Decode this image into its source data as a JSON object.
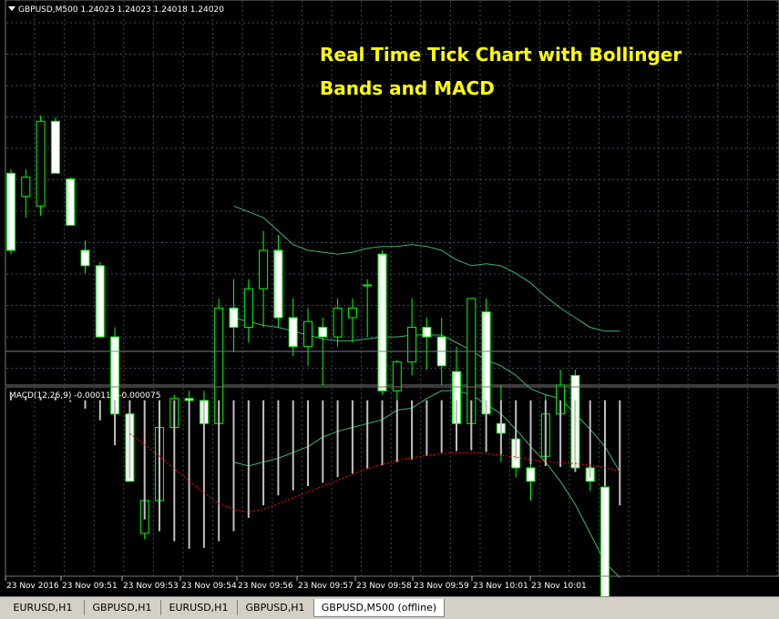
{
  "header": {
    "symbol_info": "GBPUSD,M500  1.24023 1.24023 1.24018 1.24020",
    "menu_icon": "triangle-down-icon"
  },
  "annotation": {
    "line1": "Real Time Tick Chart with Bollinger",
    "line2": "Bands and MACD",
    "color": "#ffff00"
  },
  "macd_panel": {
    "label": "MACD(12,26,9) -0.000119 -0.000075"
  },
  "time_axis": {
    "labels": [
      "23 Nov 2016",
      "23 Nov 09:51",
      "23 Nov 09:53",
      "23 Nov 09:54",
      "23 Nov 09:56",
      "23 Nov 09:57",
      "23 Nov 09:58",
      "23 Nov 09:59",
      "23 Nov 10:01",
      "23 Nov 10:01"
    ]
  },
  "tabs": [
    {
      "label": "EURUSD,H1",
      "active": false
    },
    {
      "label": "GBPUSD,H1",
      "active": false
    },
    {
      "label": "EURUSD,H1",
      "active": false
    },
    {
      "label": "GBPUSD,H1",
      "active": false
    },
    {
      "label": "GBPUSD,M500 (offline)",
      "active": true
    }
  ],
  "colors": {
    "background": "#000000",
    "grid": "#3a4a5a",
    "candle_border": "#00ff00",
    "bull_fill": "#000000",
    "bear_fill": "#ffffff",
    "bands": "#3cb371",
    "histogram": "#c0c0c0",
    "signal": "#ff0000",
    "bid_line": "#708090"
  },
  "chart_data": [
    {
      "type": "candlestick",
      "ylim": [
        1.239,
        1.241
      ],
      "grid": true,
      "candles": [
        {
          "o": 1.2401,
          "h": 1.24012,
          "l": 1.23968,
          "c": 1.2397
        },
        {
          "o": 1.23998,
          "h": 1.24012,
          "l": 1.23987,
          "c": 1.24008
        },
        {
          "o": 1.23993,
          "h": 1.2404,
          "l": 1.23988,
          "c": 1.24037
        },
        {
          "o": 1.24037,
          "h": 1.24039,
          "l": 1.2401,
          "c": 1.2401
        },
        {
          "o": 1.24007,
          "h": 1.24008,
          "l": 1.23983,
          "c": 1.23983
        },
        {
          "o": 1.2397,
          "h": 1.23975,
          "l": 1.23958,
          "c": 1.23962
        },
        {
          "o": 1.23962,
          "h": 1.23964,
          "l": 1.23925,
          "c": 1.23925
        },
        {
          "o": 1.23925,
          "h": 1.2393,
          "l": 1.23885,
          "c": 1.23885
        },
        {
          "o": 1.23885,
          "h": 1.2389,
          "l": 1.2385,
          "c": 1.2385
        },
        {
          "o": 1.23823,
          "h": 1.23845,
          "l": 1.2382,
          "c": 1.2384
        },
        {
          "o": 1.2384,
          "h": 1.2388,
          "l": 1.23838,
          "c": 1.23878
        },
        {
          "o": 1.23878,
          "h": 1.23895,
          "l": 1.23873,
          "c": 1.23893
        },
        {
          "o": 1.23893,
          "h": 1.23897,
          "l": 1.23865,
          "c": 1.23892
        },
        {
          "o": 1.23892,
          "h": 1.23897,
          "l": 1.23863,
          "c": 1.2388
        },
        {
          "o": 1.2388,
          "h": 1.23945,
          "l": 1.23878,
          "c": 1.2394
        },
        {
          "o": 1.2394,
          "h": 1.23955,
          "l": 1.23917,
          "c": 1.2393
        },
        {
          "o": 1.2393,
          "h": 1.23955,
          "l": 1.23922,
          "c": 1.2395
        },
        {
          "o": 1.2395,
          "h": 1.2398,
          "l": 1.2393,
          "c": 1.2397
        },
        {
          "o": 1.2397,
          "h": 1.23978,
          "l": 1.2393,
          "c": 1.23935
        },
        {
          "o": 1.23935,
          "h": 1.23945,
          "l": 1.23915,
          "c": 1.2392
        },
        {
          "o": 1.2392,
          "h": 1.2394,
          "l": 1.2391,
          "c": 1.23933
        },
        {
          "o": 1.2393,
          "h": 1.23935,
          "l": 1.239,
          "c": 1.23925
        },
        {
          "o": 1.23925,
          "h": 1.23945,
          "l": 1.2392,
          "c": 1.2394
        },
        {
          "o": 1.23935,
          "h": 1.23945,
          "l": 1.23922,
          "c": 1.2394
        },
        {
          "o": 1.23952,
          "h": 1.23955,
          "l": 1.23925,
          "c": 1.23952
        },
        {
          "o": 1.23968,
          "h": 1.2397,
          "l": 1.23895,
          "c": 1.23897
        },
        {
          "o": 1.23897,
          "h": 1.23913,
          "l": 1.2389,
          "c": 1.23912
        },
        {
          "o": 1.23912,
          "h": 1.23945,
          "l": 1.23905,
          "c": 1.2393
        },
        {
          "o": 1.2393,
          "h": 1.23935,
          "l": 1.23908,
          "c": 1.23925
        },
        {
          "o": 1.23925,
          "h": 1.23935,
          "l": 1.239,
          "c": 1.2391
        },
        {
          "o": 1.23907,
          "h": 1.2392,
          "l": 1.23892,
          "c": 1.2388
        },
        {
          "o": 1.2388,
          "h": 1.23945,
          "l": 1.2387,
          "c": 1.23945
        },
        {
          "o": 1.23938,
          "h": 1.23945,
          "l": 1.23885,
          "c": 1.23885
        },
        {
          "o": 1.2388,
          "h": 1.239,
          "l": 1.2386,
          "c": 1.23875
        },
        {
          "o": 1.23872,
          "h": 1.2388,
          "l": 1.23852,
          "c": 1.23857
        },
        {
          "o": 1.23857,
          "h": 1.2388,
          "l": 1.2384,
          "c": 1.2385
        },
        {
          "o": 1.23863,
          "h": 1.23895,
          "l": 1.23858,
          "c": 1.23885
        },
        {
          "o": 1.23885,
          "h": 1.23908,
          "l": 1.2387,
          "c": 1.239
        },
        {
          "o": 1.23905,
          "h": 1.23908,
          "l": 1.23857,
          "c": 1.23857
        },
        {
          "o": 1.23857,
          "h": 1.23865,
          "l": 1.23845,
          "c": 1.2385
        },
        {
          "o": 1.23847,
          "h": 1.2385,
          "l": 1.23785,
          "c": 1.23787
        },
        {
          "o": 1.23785,
          "h": 1.23788,
          "l": 1.2378,
          "c": 1.23781
        }
      ],
      "bollinger_upper": [
        null,
        null,
        null,
        null,
        null,
        null,
        null,
        null,
        null,
        null,
        null,
        null,
        null,
        null,
        null,
        1.23993,
        1.2399,
        1.23987,
        1.2398,
        1.23973,
        1.2397,
        1.23969,
        1.23968,
        1.23969,
        1.23971,
        1.23972,
        1.23972,
        1.23973,
        1.23972,
        1.2397,
        1.23965,
        1.23962,
        1.23963,
        1.23962,
        1.23958,
        1.23953,
        1.23946,
        1.2394,
        1.23935,
        1.2393,
        1.23928,
        1.23928
      ],
      "bollinger_middle": [
        null,
        null,
        null,
        null,
        null,
        null,
        null,
        null,
        null,
        null,
        null,
        null,
        null,
        null,
        null,
        1.23935,
        1.23933,
        1.23931,
        1.2393,
        1.23928,
        1.23926,
        1.23924,
        1.23923,
        1.23923,
        1.23924,
        1.23925,
        1.23925,
        1.23926,
        1.23926,
        1.23926,
        1.23922,
        1.23918,
        1.23913,
        1.2391,
        1.23905,
        1.23898,
        1.23895,
        1.23893,
        1.23885,
        1.23877,
        1.23868,
        1.23855
      ],
      "bollinger_lower": [
        null,
        null,
        null,
        null,
        null,
        null,
        null,
        null,
        null,
        null,
        null,
        null,
        null,
        null,
        null,
        1.2386,
        1.23858,
        1.2386,
        1.23862,
        1.23865,
        1.23868,
        1.23873,
        1.23876,
        1.23878,
        1.2388,
        1.23882,
        1.23887,
        1.23888,
        1.23893,
        1.23897,
        1.23897,
        1.23895,
        1.2389,
        1.23885,
        1.23877,
        1.23868,
        1.2386,
        1.2385,
        1.23838,
        1.23823,
        1.23808,
        1.238
      ]
    },
    {
      "type": "bar",
      "title": "MACD(12,26,9) -0.000119 -0.000075",
      "ylim": [
        -0.00021,
        1.5e-05
      ],
      "macd_histogram": [
        5e-06,
        5e-06,
        4e-06,
        4e-06,
        -2e-06,
        -1e-05,
        -2.4e-05,
        -5.4e-05,
        -9.4e-05,
        -0.000143,
        -0.000157,
        -0.000169,
        -0.000178,
        -0.000177,
        -0.000169,
        -0.000157,
        -0.000141,
        -0.000126,
        -0.000114,
        -0.000108,
        -0.000103,
        -9.9e-05,
        -9.2e-05,
        -8.8e-05,
        -8.2e-05,
        -7.8e-05,
        -7.4e-05,
        -7.1e-05,
        -6.7e-05,
        -6.3e-05,
        -6.1e-05,
        -6e-05,
        -6.2e-05,
        -6.5e-05,
        -7.1e-05,
        -7.7e-05,
        -7.9e-05,
        -8e-05,
        -8.6e-05,
        -9.3e-05,
        -0.000103,
        -0.000126
      ],
      "signal": [
        null,
        null,
        null,
        null,
        null,
        null,
        null,
        null,
        -4e-05,
        -5.3e-05,
        -6.7e-05,
        -8.2e-05,
        -9.7e-05,
        -0.000111,
        -0.000124,
        -0.000131,
        -0.000134,
        -0.000131,
        -0.000124,
        -0.000117,
        -0.00011,
        -0.000103,
        -9.6e-05,
        -8.9e-05,
        -8.2e-05,
        -7.7e-05,
        -7.2e-05,
        -6.9e-05,
        -6.6e-05,
        -6.4e-05,
        -6.3e-05,
        -6.3e-05,
        -6.4e-05,
        -6.6e-05,
        -6.8e-05,
        -7.1e-05,
        -7.3e-05,
        -7.5e-05,
        -7.6e-05,
        -7.8e-05,
        -8.1e-05,
        -8.5e-05
      ]
    }
  ]
}
